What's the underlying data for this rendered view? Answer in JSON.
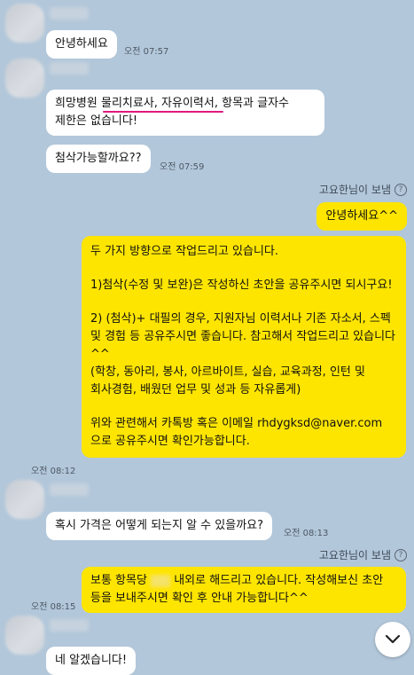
{
  "messages": {
    "m1": {
      "text": "안녕하세요",
      "time": "오전 07:57"
    },
    "m2": {
      "text_before": "희망병원  ",
      "text_highlight": "물리치료사, 자유이력서",
      "text_after": ", 항목과 글자수 제한은 없습니다!"
    },
    "m3": {
      "text": "첨삭가능할까요??",
      "time": "오전 07:59"
    },
    "sender_label": "고요한님이 보냄",
    "m4": {
      "text": "안녕하세요^^"
    },
    "m5": {
      "p1": "두 가지 방향으로 작업드리고 있습니다.",
      "p2": "1)첨삭(수정 및 보완)은 작성하신 초안을 공유주시면 되시구요!",
      "p3": "2) (첨삭)+ 대필의 경우, 지원자님 이력서나 기존 자소서, 스펙 및 경험 등 공유주시면 좋습니다. 참고해서 작업드리고 있습니다^^\n(학창, 동아리, 봉사, 아르바이트, 실습, 교육과정, 인턴 및 회사경험, 배웠던 업무 및 성과 등 자유롭게)",
      "p4": "위와 관련해서 카톡방 혹은 이메일 rhdygksd@naver.com 으로 공유주시면 확인가능합니다.",
      "time": "오전 08:12"
    },
    "m6": {
      "text": "혹시 가격은 어떻게 되는지 알 수 있을까요?",
      "time": "오전 08:13"
    },
    "m7": {
      "text_before": "보통 항목당 ",
      "text_after": " 내외로 해드리고 있습니다. 작성해보신 초안 등을 보내주시면 확인 후 안내 가능합니다^^",
      "time": "오전 08:15"
    },
    "m8": {
      "text": "네 알겠습니다!"
    }
  },
  "icons": {
    "help": "?",
    "scroll_down": "chevron-down-icon"
  },
  "colors": {
    "background": "#b2c7da",
    "sent_bubble": "#fee500",
    "received_bubble": "#ffffff",
    "highlight_underline": "#e0197d"
  }
}
